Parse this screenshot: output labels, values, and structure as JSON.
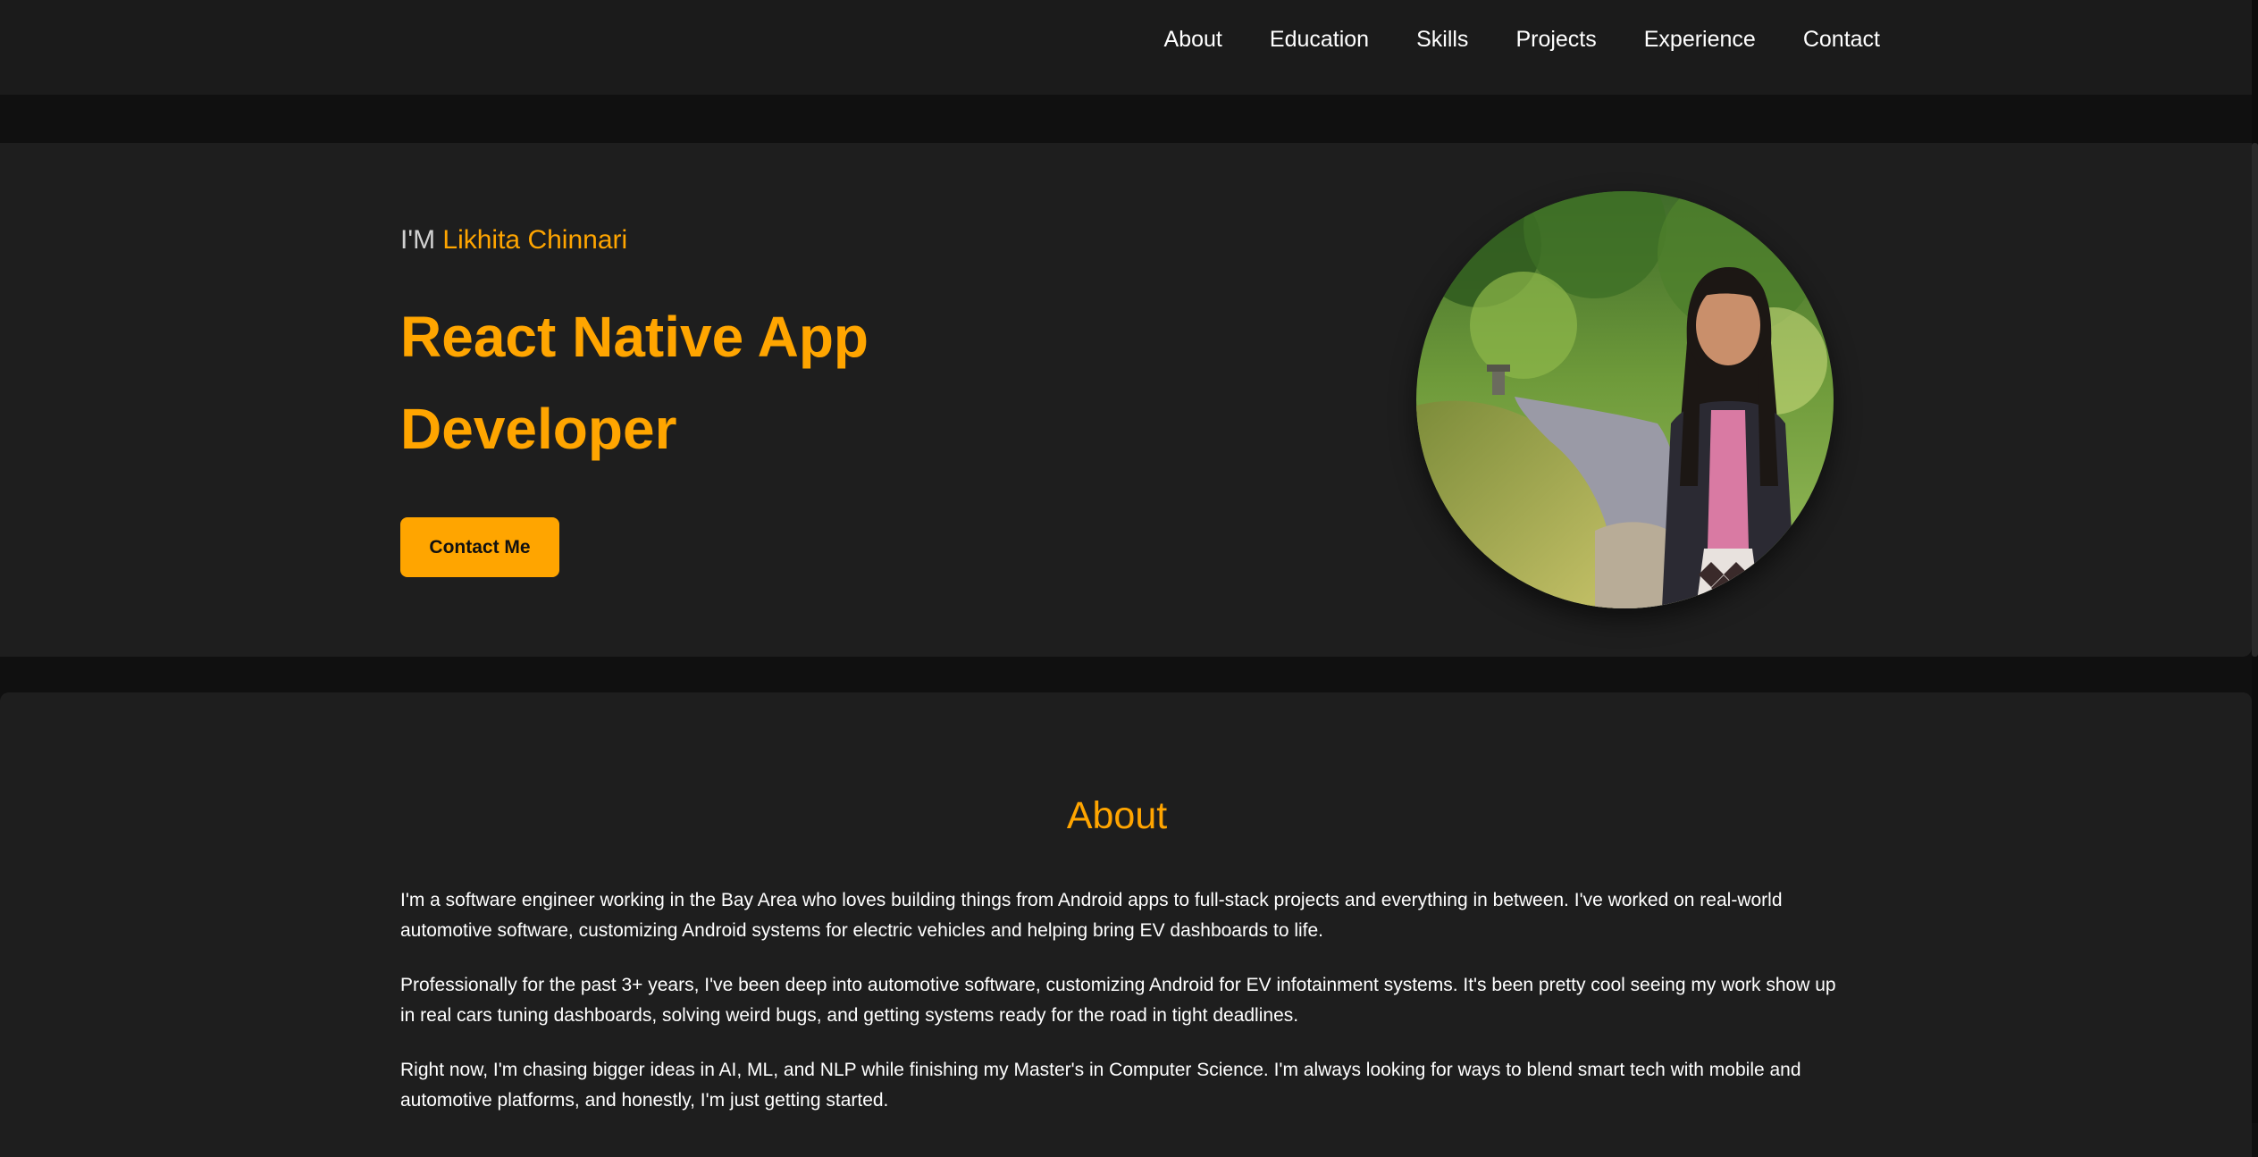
{
  "nav": {
    "items": [
      {
        "label": "About"
      },
      {
        "label": "Education"
      },
      {
        "label": "Skills"
      },
      {
        "label": "Projects"
      },
      {
        "label": "Experience"
      },
      {
        "label": "Contact"
      }
    ]
  },
  "hero": {
    "intro_prefix": "I'M ",
    "name": "Likhita Chinnari",
    "title": "React Native App Developer",
    "cta_label": "Contact Me",
    "photo_icon": "profile-photo"
  },
  "about": {
    "heading": "About",
    "paragraphs": [
      "I'm a software engineer working in the Bay Area who loves building things from Android apps to full-stack projects and everything in between. I've worked on real-world automotive software, customizing Android systems for electric vehicles and helping bring EV dashboards to life.",
      "Professionally for the past 3+ years, I've been deep into automotive software, customizing Android for EV infotainment systems. It's been pretty cool seeing my work show up in real cars tuning dashboards, solving weird bugs, and getting systems ready for the road in tight deadlines.",
      "Right now, I'm chasing bigger ideas in AI, ML, and NLP while finishing my Master's in Computer Science. I'm always looking for ways to blend smart tech with mobile and automotive platforms, and honestly, I'm just getting started."
    ]
  },
  "colors": {
    "accent": "#ffa500",
    "background": "#101010",
    "panel": "#1e1e1e",
    "navbar": "#1b1b1b"
  }
}
